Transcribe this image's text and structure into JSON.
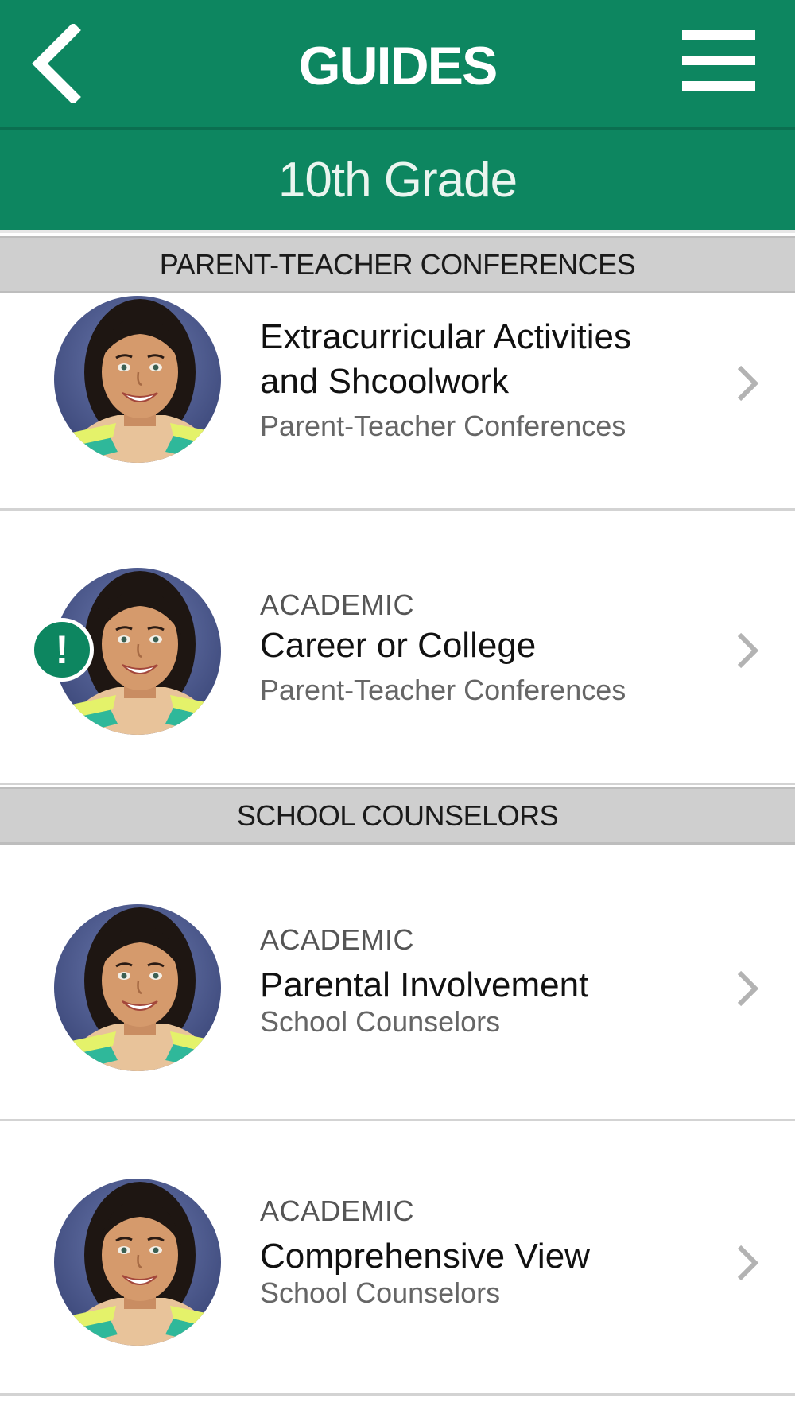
{
  "header": {
    "title": "GUIDES",
    "subtitle": "10th Grade"
  },
  "colors": {
    "brand_green": "#0d8660",
    "section_bg": "#cfcfcf",
    "chevron": "#b3b3b3"
  },
  "sections": [
    {
      "label": "PARENT-TEACHER CONFERENCES",
      "items": [
        {
          "category": "",
          "title_line1": "Extracurricular Activities",
          "title_line2": "and Shcoolwork",
          "subtitle": "Parent-Teacher Conferences",
          "alert": false
        },
        {
          "category": "ACADEMIC",
          "title_line1": "Career or College",
          "subtitle": "Parent-Teacher Conferences",
          "alert": true,
          "alert_symbol": "!"
        }
      ]
    },
    {
      "label": "SCHOOL COUNSELORS",
      "items": [
        {
          "category": "ACADEMIC",
          "title_line1": "Parental Involvement",
          "subtitle": "School Counselors",
          "alert": false
        },
        {
          "category": "ACADEMIC",
          "title_line1": "Comprehensive View",
          "subtitle": "School Counselors",
          "alert": false
        }
      ]
    }
  ],
  "icons": {
    "back": "chevron-left-icon",
    "menu": "hamburger-menu-icon",
    "row_arrow": "chevron-right-icon",
    "alert": "exclamation-icon",
    "thumbnail": "student-photo"
  }
}
